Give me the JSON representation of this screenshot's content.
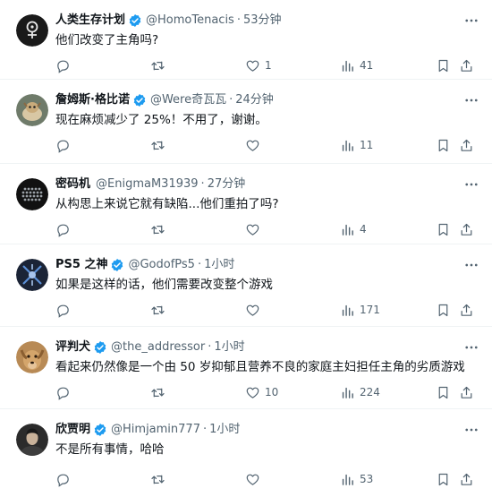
{
  "tweets": [
    {
      "name": "人类生存计划",
      "handle": "@HomoTenacis",
      "time": "53分钟",
      "text": "他们改变了主角吗?",
      "replies": "",
      "retweets": "",
      "likes": "1",
      "views": "41",
      "avatar": "homo-logo"
    },
    {
      "name": "詹姆斯·格比诺",
      "handle": "@Were奇瓦瓦",
      "time": "24分钟",
      "text": "现在麻烦减少了 25%！不用了，谢谢。",
      "replies": "",
      "retweets": "",
      "likes": "",
      "views": "11",
      "avatar": "pet-photo"
    },
    {
      "name": "密码机",
      "handle": "@EnigmaM31939",
      "time": "27分钟",
      "text": "从构思上来说它就有缺陷...他们重拍了吗?",
      "replies": "",
      "retweets": "",
      "likes": "",
      "views": "4",
      "avatar": "dot-grid"
    },
    {
      "name": "PS5 之神",
      "handle": "@GodofPs5",
      "time": "1小时",
      "text": "如果是这样的话，他们需要改变整个游戏",
      "replies": "",
      "retweets": "",
      "likes": "",
      "views": "171",
      "avatar": "emblem"
    },
    {
      "name": "评判犬",
      "handle": "@the_addressor",
      "time": "1小时",
      "text": "看起来仍然像是一个由 50 岁抑郁且营养不良的家庭主妇担任主角的劣质游戏",
      "replies": "",
      "retweets": "",
      "likes": "10",
      "views": "224",
      "avatar": "dog-photo"
    },
    {
      "name": "欣贾明",
      "handle": "@Himjamin777",
      "time": "1小时",
      "text": "不是所有事情，哈哈",
      "replies": "",
      "retweets": "",
      "likes": "",
      "views": "53",
      "avatar": "person-photo"
    }
  ],
  "colors": {
    "verified": "#1d9bf0",
    "muted": "#536471",
    "text": "#0f1419"
  },
  "separator": "·"
}
